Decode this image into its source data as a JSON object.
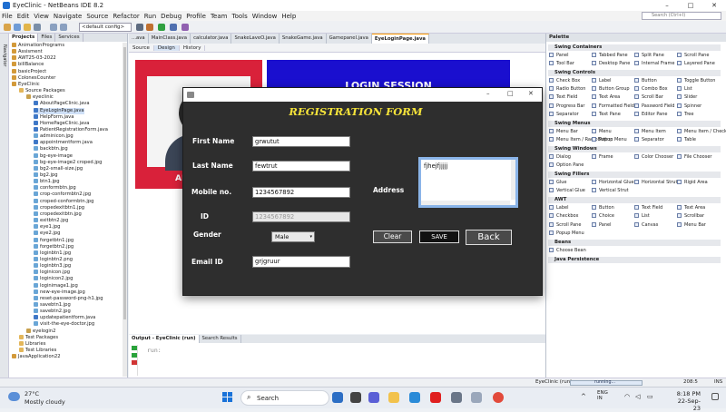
{
  "window": {
    "title": "EyeClinic - NetBeans IDE 8.2",
    "minimize_icon": "minimize-icon",
    "maximize_icon": "maximize-icon",
    "close_icon": "close-icon"
  },
  "menu": [
    "File",
    "Edit",
    "View",
    "Navigate",
    "Source",
    "Refactor",
    "Run",
    "Debug",
    "Profile",
    "Team",
    "Tools",
    "Window",
    "Help"
  ],
  "search": {
    "placeholder": "Search (Ctrl+I)"
  },
  "toolbar": {
    "config": "<default config>"
  },
  "left_strip": {
    "label": "Navigator"
  },
  "projects": {
    "tabs": [
      "Projects",
      "Files",
      "Services"
    ],
    "tree": [
      {
        "label": "AnimationPrograms",
        "level": 0,
        "kind": "project"
      },
      {
        "label": "Assisment",
        "level": 0,
        "kind": "project"
      },
      {
        "label": "AWT25-03-2022",
        "level": 0,
        "kind": "project"
      },
      {
        "label": "billBalance",
        "level": 0,
        "kind": "project"
      },
      {
        "label": "basicProject",
        "level": 0,
        "kind": "project"
      },
      {
        "label": "ColonesCounter",
        "level": 0,
        "kind": "project"
      },
      {
        "label": "EyeClinic",
        "level": 0,
        "kind": "project"
      },
      {
        "label": "Source Packages",
        "level": 1,
        "kind": "folder"
      },
      {
        "label": "eyeclinic",
        "level": 2,
        "kind": "package"
      },
      {
        "label": "AboutPageClinic.java",
        "level": 3,
        "kind": "java"
      },
      {
        "label": "EyeLoginPage.java",
        "level": 3,
        "kind": "java"
      },
      {
        "label": "HelpForm.java",
        "level": 3,
        "kind": "java"
      },
      {
        "label": "HomePageClinic.java",
        "level": 3,
        "kind": "java"
      },
      {
        "label": "PatientRegistrationForm.java",
        "level": 3,
        "kind": "java"
      },
      {
        "label": "adminicon.jpg",
        "level": 3,
        "kind": "img"
      },
      {
        "label": "appointmentform.java",
        "level": 3,
        "kind": "java"
      },
      {
        "label": "backbtn.jpg",
        "level": 3,
        "kind": "img"
      },
      {
        "label": "bg-eye-image",
        "level": 3,
        "kind": "img"
      },
      {
        "label": "bg-eye-image2 croped.jpg",
        "level": 3,
        "kind": "img"
      },
      {
        "label": "bg2-small-size.jpg",
        "level": 3,
        "kind": "img"
      },
      {
        "label": "bg2.jpg",
        "level": 3,
        "kind": "img"
      },
      {
        "label": "btn1.jpg",
        "level": 3,
        "kind": "img"
      },
      {
        "label": "conformbtn.jpg",
        "level": 3,
        "kind": "img"
      },
      {
        "label": "crop-conformbtn2.jpg",
        "level": 3,
        "kind": "img"
      },
      {
        "label": "croped-conformbtn.jpg",
        "level": 3,
        "kind": "img"
      },
      {
        "label": "cropedexitbtn1.jpg",
        "level": 3,
        "kind": "img"
      },
      {
        "label": "cropedexitbtn.jpg",
        "level": 3,
        "kind": "img"
      },
      {
        "label": "exitbtn2.jpg",
        "level": 3,
        "kind": "img"
      },
      {
        "label": "eye1.jpg",
        "level": 3,
        "kind": "img"
      },
      {
        "label": "eye2.jpg",
        "level": 3,
        "kind": "img"
      },
      {
        "label": "forgetbtn1.jpg",
        "level": 3,
        "kind": "img"
      },
      {
        "label": "forgetbtn2.jpg",
        "level": 3,
        "kind": "img"
      },
      {
        "label": "loginbtn1.jpg",
        "level": 3,
        "kind": "img"
      },
      {
        "label": "loginbtn2.png",
        "level": 3,
        "kind": "img"
      },
      {
        "label": "loginbtn3.jpg",
        "level": 3,
        "kind": "img"
      },
      {
        "label": "loginicon.jpg",
        "level": 3,
        "kind": "img"
      },
      {
        "label": "loginicon2.jpg",
        "level": 3,
        "kind": "img"
      },
      {
        "label": "loginimage1.jpg",
        "level": 3,
        "kind": "img"
      },
      {
        "label": "new-eye-image.jpg",
        "level": 3,
        "kind": "img"
      },
      {
        "label": "reset-password-png-h1.jpg",
        "level": 3,
        "kind": "img"
      },
      {
        "label": "savebtn1.jpg",
        "level": 3,
        "kind": "img"
      },
      {
        "label": "savebtn2.jpg",
        "level": 3,
        "kind": "img"
      },
      {
        "label": "updatepatientform.java",
        "level": 3,
        "kind": "java"
      },
      {
        "label": "visit-the-eye-doctor.jpg",
        "level": 3,
        "kind": "img"
      },
      {
        "label": "eyelogin2",
        "level": 2,
        "kind": "package"
      },
      {
        "label": "Test Packages",
        "level": 1,
        "kind": "folder"
      },
      {
        "label": "Libraries",
        "level": 1,
        "kind": "folder"
      },
      {
        "label": "Test Libraries",
        "level": 1,
        "kind": "folder"
      },
      {
        "label": "JavaApplication22",
        "level": 0,
        "kind": "project"
      }
    ]
  },
  "editor": {
    "tabs": [
      "...ava",
      "MainClass.java",
      "calculator.java",
      "SnakeLaveO.java",
      "SnakeGame.java",
      "Gamepanel.java",
      "EyeLoginPage.java"
    ],
    "active_tab": "EyeLoginPage.java",
    "subtabs": [
      "Source",
      "Design",
      "History"
    ],
    "active_subtab": "Design",
    "background_heading": "LOGIN SESSION",
    "background_label": "AD"
  },
  "palette": {
    "title": "Palette",
    "sections": [
      {
        "name": "Swing Containers",
        "items": [
          "Panel",
          "Tabbed Pane",
          "Split Pane",
          "Scroll Pane",
          "Tool Bar",
          "Desktop Pane",
          "Internal Frame",
          "Layered Pane"
        ]
      },
      {
        "name": "Swing Controls",
        "items": [
          "Check Box",
          "Label",
          "Button",
          "Toggle Button",
          "Radio Button",
          "Button Group",
          "Combo Box",
          "List",
          "Text Field",
          "Text Area",
          "Scroll Bar",
          "Slider",
          "Progress Bar",
          "Formatted Field",
          "Password Field",
          "Spinner",
          "Separator",
          "Text Pane",
          "Editor Pane",
          "Tree"
        ]
      },
      {
        "name": "Swing Menus",
        "items": [
          "Menu Bar",
          "Menu",
          "Menu Item",
          "Menu Item / CheckBox",
          "Menu Item / RadioButton",
          "Popup Menu",
          "Separator",
          "Table"
        ]
      },
      {
        "name": "Swing Windows",
        "items": [
          "Dialog",
          "Frame",
          "Color Chooser",
          "File Chooser",
          "Option Pane"
        ]
      },
      {
        "name": "Swing Fillers",
        "items": [
          "Glue",
          "Horizontal Glue",
          "Horizontal Strut",
          "Rigid Area",
          "Vertical Glue",
          "Vertical Strut"
        ]
      },
      {
        "name": "AWT",
        "items": [
          "Label",
          "Button",
          "Text Field",
          "Text Area",
          "Checkbox",
          "Choice",
          "List",
          "Scrollbar",
          "Scroll Pane",
          "Panel",
          "Canvas",
          "Menu Bar",
          "Popup Menu"
        ]
      },
      {
        "name": "Beans",
        "items": [
          "Choose Bean"
        ]
      },
      {
        "name": "Java Persistence",
        "items": []
      }
    ]
  },
  "output": {
    "tabs": [
      "Output - EyeClinic (run)",
      "Search Results"
    ],
    "text": "run:"
  },
  "statusbar": {
    "project": "EyeClinic (run)",
    "progress": "running...",
    "position": "208:5",
    "mode": "INS"
  },
  "dialog": {
    "title": "REGISTRATION FORM",
    "fields": {
      "first_name": {
        "label": "First Name",
        "value": "grwutut"
      },
      "last_name": {
        "label": "Last Name",
        "value": "fewtrut"
      },
      "mobile": {
        "label": "Mobile no.",
        "value": "1234567892"
      },
      "id": {
        "label": "ID",
        "value": "1234567892"
      },
      "gender": {
        "label": "Gender",
        "value": "Male"
      },
      "email": {
        "label": "Email ID",
        "value": "grjgruur"
      },
      "address": {
        "label": "Address",
        "value": "fjhejfjjjjj"
      }
    },
    "buttons": {
      "clear": "Clear",
      "save": "SAVE",
      "back": "Back"
    }
  },
  "taskbar": {
    "weather_temp": "27°C",
    "weather_desc": "Mostly cloudy",
    "search": "Search",
    "language": "ENG",
    "region": "IN",
    "time": "8:18 PM",
    "date": "22-Sep-23"
  }
}
